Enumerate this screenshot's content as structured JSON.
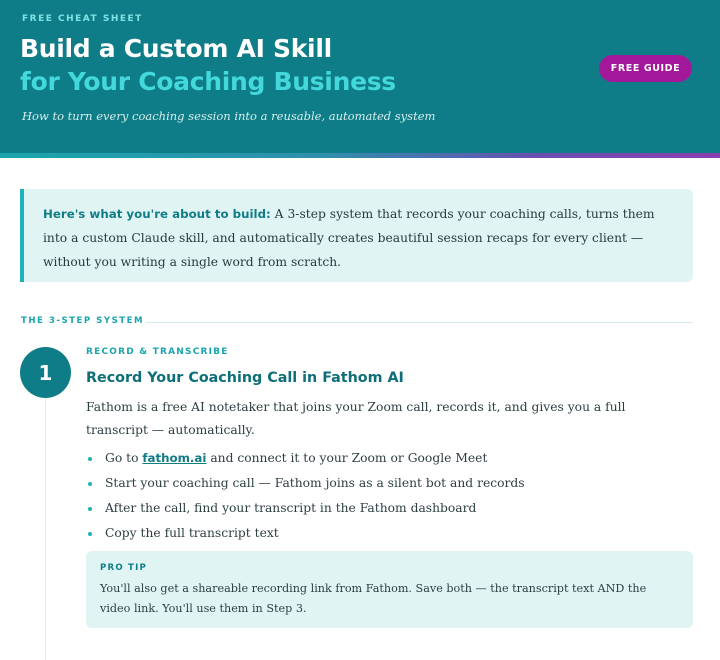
{
  "header": {
    "eyebrow": "FREE CHEAT SHEET",
    "title_line1": "Build a Custom AI Skill",
    "title_line2": "for Your Coaching Business",
    "subtitle": "How to turn every coaching session into a reusable, automated system",
    "badge": "FREE GUIDE"
  },
  "intro": {
    "lead": "Here's what you're about to build:",
    "text": " A 3-step system that records your coaching calls, turns them into a custom Claude skill, and automatically creates beautiful session recaps for every client — without you writing a single word from scratch."
  },
  "section": {
    "label": "THE 3-STEP SYSTEM"
  },
  "step1": {
    "number": "1",
    "eyebrow": "RECORD & TRANSCRIBE",
    "title": "Record Your Coaching Call in Fathom AI",
    "body": "Fathom is a free AI notetaker that joins your Zoom call, records it, and gives you a full transcript — automatically.",
    "bullets": {
      "b1_pre": "Go to ",
      "b1_link": "fathom.ai",
      "b1_post": " and connect it to your Zoom or Google Meet",
      "b2": "Start your coaching call — Fathom joins as a silent bot and records",
      "b3": "After the call, find your transcript in the Fathom dashboard",
      "b4": "Copy the full transcript text"
    },
    "tip": {
      "label": "PRO TIP",
      "text": "You'll also get a shareable recording link from Fathom. Save both — the transcript text AND the video link. You'll use them in Step 3."
    }
  },
  "colors": {
    "hero": "#0f7d87",
    "accent": "#43d8dc",
    "badge": "#a3189a",
    "panel": "#e1f4f4"
  }
}
